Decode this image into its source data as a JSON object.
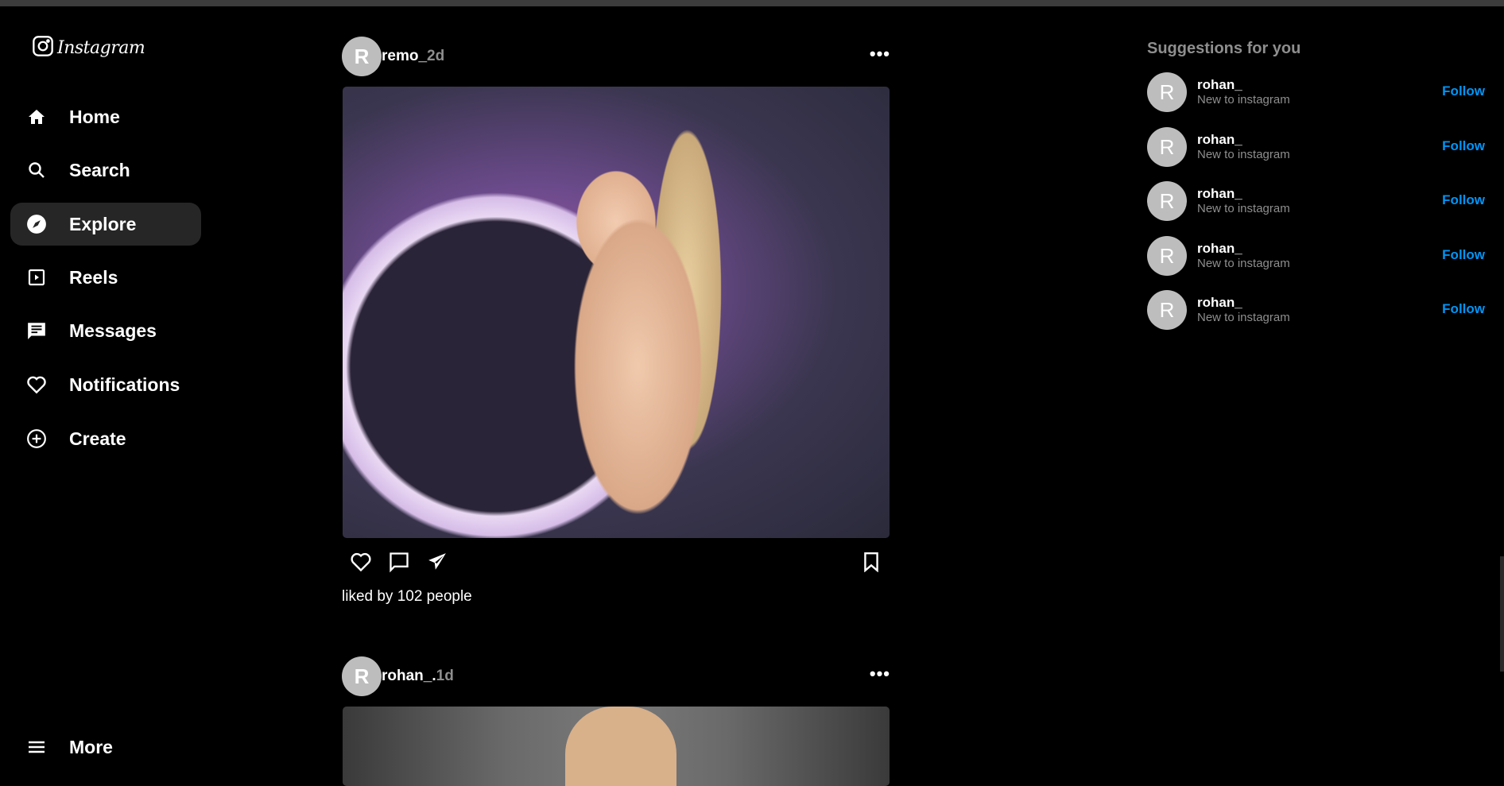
{
  "app": {
    "logo_text": "Instagram"
  },
  "sidebar": {
    "items": [
      {
        "label": "Home",
        "icon": "home-icon"
      },
      {
        "label": "Search",
        "icon": "search-icon"
      },
      {
        "label": "Explore",
        "icon": "compass-icon",
        "active": true
      },
      {
        "label": "Reels",
        "icon": "reels-icon"
      },
      {
        "label": "Messages",
        "icon": "message-icon"
      },
      {
        "label": "Notifications",
        "icon": "heart-icon"
      },
      {
        "label": "Create",
        "icon": "plus-circle-icon"
      }
    ],
    "more_label": "More"
  },
  "feed": {
    "posts": [
      {
        "avatar_letter": "R",
        "username": "remo_",
        "time": "2d",
        "likes_text": "liked by 102 people"
      },
      {
        "avatar_letter": "R",
        "username": "rohan_.",
        "time": "1d"
      }
    ]
  },
  "suggestions": {
    "title": "Suggestions for you",
    "items": [
      {
        "avatar_letter": "R",
        "name": "rohan_",
        "subtitle": "New to instagram",
        "action": "Follow"
      },
      {
        "avatar_letter": "R",
        "name": "rohan_",
        "subtitle": "New to instagram",
        "action": "Follow"
      },
      {
        "avatar_letter": "R",
        "name": "rohan_",
        "subtitle": "New to instagram",
        "action": "Follow"
      },
      {
        "avatar_letter": "R",
        "name": "rohan_",
        "subtitle": "New to instagram",
        "action": "Follow"
      },
      {
        "avatar_letter": "R",
        "name": "rohan_",
        "subtitle": "New to instagram",
        "action": "Follow"
      }
    ]
  },
  "colors": {
    "background": "#000000",
    "accent": "#0095f6",
    "muted": "#8e8e8e",
    "active_nav": "#262626"
  }
}
